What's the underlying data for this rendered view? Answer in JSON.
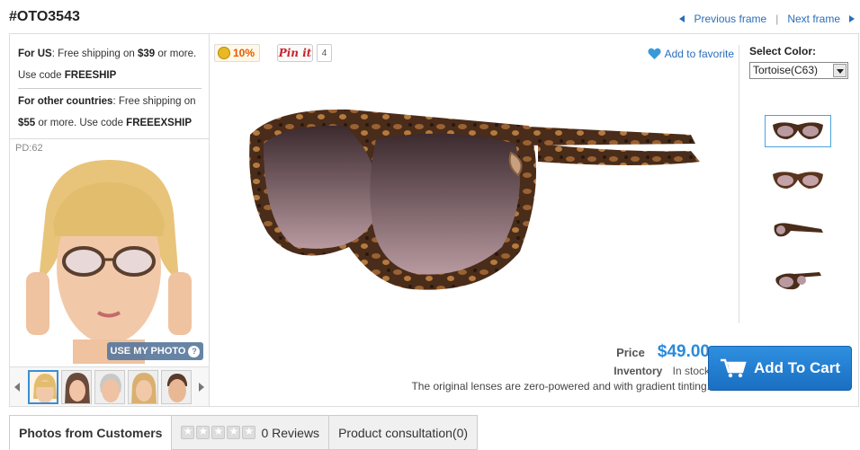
{
  "product": {
    "sku": "#OTO3543",
    "prev_frame": "Previous frame",
    "separator": "|",
    "next_frame": "Next frame"
  },
  "shipping": {
    "us_label": "For US",
    "us_text_1": ": Free shipping on ",
    "us_amount": "$39",
    "us_text_2": " or more. Use code ",
    "us_code": "FREESHIP",
    "other_label": "For other countries",
    "other_text_1": ": Free shipping on ",
    "other_amount": "$55",
    "other_text_2": " or more. Use code ",
    "other_code": "FREEEXSHIP"
  },
  "tryon": {
    "pd": "PD:62",
    "use_my_photo": "USE MY PHOTO",
    "help": "?"
  },
  "badges": {
    "discount": "10%",
    "pinit": "Pin it",
    "pin_count": "4"
  },
  "favorite": "Add to favorite",
  "color": {
    "label": "Select Color:",
    "selected": "Tortoise(C63)"
  },
  "purchase": {
    "price_label": "Price",
    "price": "$49.00",
    "inventory_label": "Inventory",
    "inventory_value": "In stock",
    "note": "The original lenses are zero-powered and with gradient tinting.",
    "add_to_cart": "Add To Cart"
  },
  "tabs": {
    "photos": "Photos from Customers",
    "reviews": "0 Reviews",
    "consultation": "Product consultation(0)"
  },
  "colors": {
    "accent": "#2a8ad9",
    "link": "#2a6ebb",
    "tortoise_dark": "#3a2418",
    "tortoise_light": "#8a5a30"
  }
}
